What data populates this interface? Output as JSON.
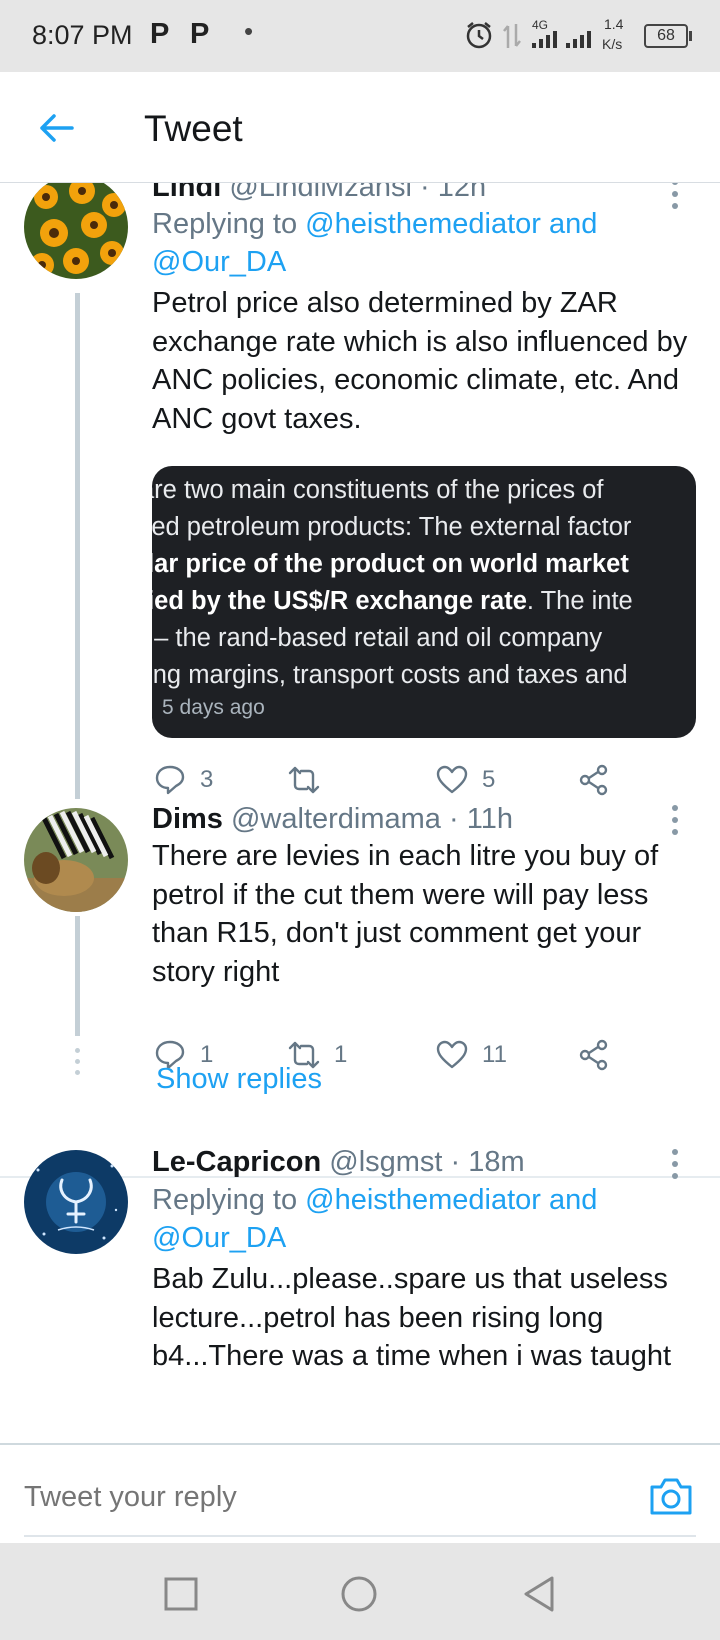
{
  "status_bar": {
    "time": "8:07 PM",
    "notif_icons": [
      "P",
      "P"
    ],
    "network_type": "4G",
    "speed": "1.4",
    "speed_unit": "K/s",
    "battery": "68"
  },
  "header": {
    "title": "Tweet"
  },
  "tweets": [
    {
      "name": "Lindi",
      "handle": "@LindiMzansi",
      "time": "12h",
      "replying_prefix": "Replying to",
      "replying_users": "@heisthemediator and @Our_DA",
      "text": "Petrol price also determined by ZAR exchange rate which is also influenced by ANC policies, economic climate, etc. And ANC govt taxes.",
      "media": {
        "lines": [
          "are two main constituents of the prices of",
          "lled petroleum products: The external factor",
          "llar price of the product on world market",
          "lied by the US$/R exchange rate",
          ". The inte",
          "; – the rand-based retail and oil company",
          "ting margins, transport costs and taxes and"
        ],
        "time": "5 days ago"
      },
      "replies": "3",
      "retweets": "",
      "likes": "5"
    },
    {
      "name": "Dims",
      "handle": "@walterdimama",
      "time": "11h",
      "text": "There are levies in each litre you buy of petrol if the cut them were will pay less than R15, don't just comment get your story right",
      "replies": "1",
      "retweets": "1",
      "likes": "11",
      "show_replies": "Show replies"
    },
    {
      "name": "Le-Capricon",
      "handle": "@lsgmst",
      "time": "18m",
      "replying_prefix": "Replying to",
      "replying_users": "@heisthemediator and @Our_DA",
      "text": "Bab Zulu...please..spare us that useless lecture...petrol has been rising long b4...There was a time when i was taught"
    }
  ],
  "reply_bar": {
    "placeholder": "Tweet your reply"
  },
  "colors": {
    "accent": "#1da1f2",
    "text": "#14171a",
    "secondary": "#657786"
  }
}
